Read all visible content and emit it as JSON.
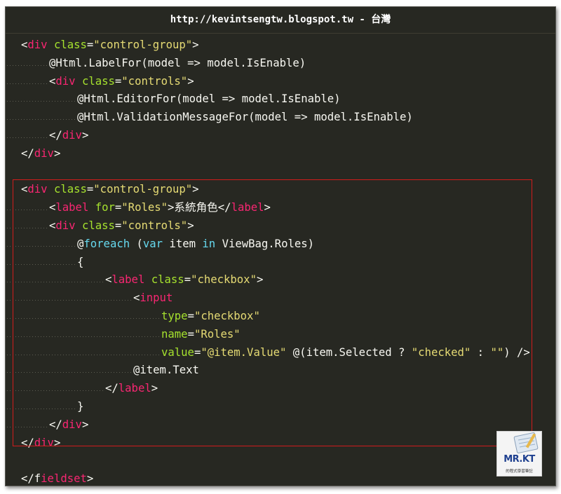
{
  "header": {
    "url_text": "http://kevintsengtw.blogspot.tw - 台灣"
  },
  "colors": {
    "background": "#272822",
    "tag": "#f92672",
    "attribute": "#a6e22e",
    "string": "#e6db74",
    "keyword": "#66d9ef",
    "plain": "#f8f8f2",
    "highlight_box": "#d11c1c"
  },
  "code_lines": [
    {
      "indent": 0,
      "tokens": [
        [
          "p",
          "<"
        ],
        [
          "t",
          "div"
        ],
        [
          "p",
          " "
        ],
        [
          "a",
          "class"
        ],
        [
          "p",
          "="
        ],
        [
          "s",
          "\"control-group\""
        ],
        [
          "p",
          ">"
        ]
      ]
    },
    {
      "indent": 1,
      "tokens": [
        [
          "p",
          "@Html.LabelFor(model => model.IsEnable)"
        ]
      ]
    },
    {
      "indent": 1,
      "tokens": [
        [
          "p",
          "<"
        ],
        [
          "t",
          "div"
        ],
        [
          "p",
          " "
        ],
        [
          "a",
          "class"
        ],
        [
          "p",
          "="
        ],
        [
          "s",
          "\"controls\""
        ],
        [
          "p",
          ">"
        ]
      ]
    },
    {
      "indent": 2,
      "tokens": [
        [
          "p",
          "@Html.EditorFor(model => model.IsEnable)"
        ]
      ]
    },
    {
      "indent": 2,
      "tokens": [
        [
          "p",
          "@Html.ValidationMessageFor(model => model.IsEnable)"
        ]
      ]
    },
    {
      "indent": 1,
      "tokens": [
        [
          "p",
          "</"
        ],
        [
          "t",
          "div"
        ],
        [
          "p",
          ">"
        ]
      ]
    },
    {
      "indent": 0,
      "tokens": [
        [
          "p",
          "</"
        ],
        [
          "t",
          "div"
        ],
        [
          "p",
          ">"
        ]
      ]
    },
    {
      "indent": 0,
      "tokens": []
    },
    {
      "indent": 0,
      "tokens": [
        [
          "p",
          "<"
        ],
        [
          "t",
          "div"
        ],
        [
          "p",
          " "
        ],
        [
          "a",
          "class"
        ],
        [
          "p",
          "="
        ],
        [
          "s",
          "\"control-group\""
        ],
        [
          "p",
          ">"
        ]
      ]
    },
    {
      "indent": 1,
      "tokens": [
        [
          "p",
          "<"
        ],
        [
          "t",
          "label"
        ],
        [
          "p",
          " "
        ],
        [
          "a",
          "for"
        ],
        [
          "p",
          "="
        ],
        [
          "s",
          "\"Roles\""
        ],
        [
          "p",
          ">系統角色</"
        ],
        [
          "t",
          "label"
        ],
        [
          "p",
          ">"
        ]
      ]
    },
    {
      "indent": 1,
      "tokens": [
        [
          "p",
          "<"
        ],
        [
          "t",
          "div"
        ],
        [
          "p",
          " "
        ],
        [
          "a",
          "class"
        ],
        [
          "p",
          "="
        ],
        [
          "s",
          "\"controls\""
        ],
        [
          "p",
          ">"
        ]
      ]
    },
    {
      "indent": 2,
      "tokens": [
        [
          "p",
          "@"
        ],
        [
          "k",
          "foreach"
        ],
        [
          "p",
          " ("
        ],
        [
          "k",
          "var"
        ],
        [
          "p",
          " item "
        ],
        [
          "k",
          "in"
        ],
        [
          "p",
          " ViewBag.Roles)"
        ]
      ]
    },
    {
      "indent": 2,
      "tokens": [
        [
          "p",
          "{"
        ]
      ]
    },
    {
      "indent": 3,
      "tokens": [
        [
          "p",
          "<"
        ],
        [
          "t",
          "label"
        ],
        [
          "p",
          " "
        ],
        [
          "a",
          "class"
        ],
        [
          "p",
          "="
        ],
        [
          "s",
          "\"checkbox\""
        ],
        [
          "p",
          ">"
        ]
      ]
    },
    {
      "indent": 4,
      "tokens": [
        [
          "p",
          "<"
        ],
        [
          "t",
          "input"
        ]
      ]
    },
    {
      "indent": 5,
      "tokens": [
        [
          "a",
          "type"
        ],
        [
          "p",
          "="
        ],
        [
          "s",
          "\"checkbox\""
        ]
      ]
    },
    {
      "indent": 5,
      "tokens": [
        [
          "a",
          "name"
        ],
        [
          "p",
          "="
        ],
        [
          "s",
          "\"Roles\""
        ]
      ]
    },
    {
      "indent": 5,
      "tokens": [
        [
          "a",
          "value"
        ],
        [
          "p",
          "="
        ],
        [
          "s",
          "\"@item.Value\""
        ],
        [
          "p",
          " @(item.Selected ? "
        ],
        [
          "s",
          "\"checked\""
        ],
        [
          "p",
          " : "
        ],
        [
          "s",
          "\"\""
        ],
        [
          "p",
          ") />"
        ]
      ]
    },
    {
      "indent": 4,
      "tokens": [
        [
          "p",
          "@item.Text"
        ]
      ]
    },
    {
      "indent": 3,
      "tokens": [
        [
          "p",
          "</"
        ],
        [
          "t",
          "label"
        ],
        [
          "p",
          ">"
        ]
      ]
    },
    {
      "indent": 2,
      "tokens": [
        [
          "p",
          "}"
        ]
      ]
    },
    {
      "indent": 1,
      "tokens": [
        [
          "p",
          "</"
        ],
        [
          "t",
          "div"
        ],
        [
          "p",
          ">"
        ]
      ]
    },
    {
      "indent": 0,
      "tokens": [
        [
          "p",
          "</"
        ],
        [
          "t",
          "div"
        ],
        [
          "p",
          ">"
        ]
      ]
    },
    {
      "indent": 0,
      "tokens": []
    },
    {
      "indent": 0,
      "tokens": [
        [
          "p",
          "<"
        ],
        [
          "p",
          "/f"
        ],
        [
          "t",
          "ieldset"
        ],
        [
          "p",
          ">"
        ]
      ]
    }
  ],
  "logo": {
    "brand": "MR.KT",
    "tagline": "的程式學習筆記"
  }
}
